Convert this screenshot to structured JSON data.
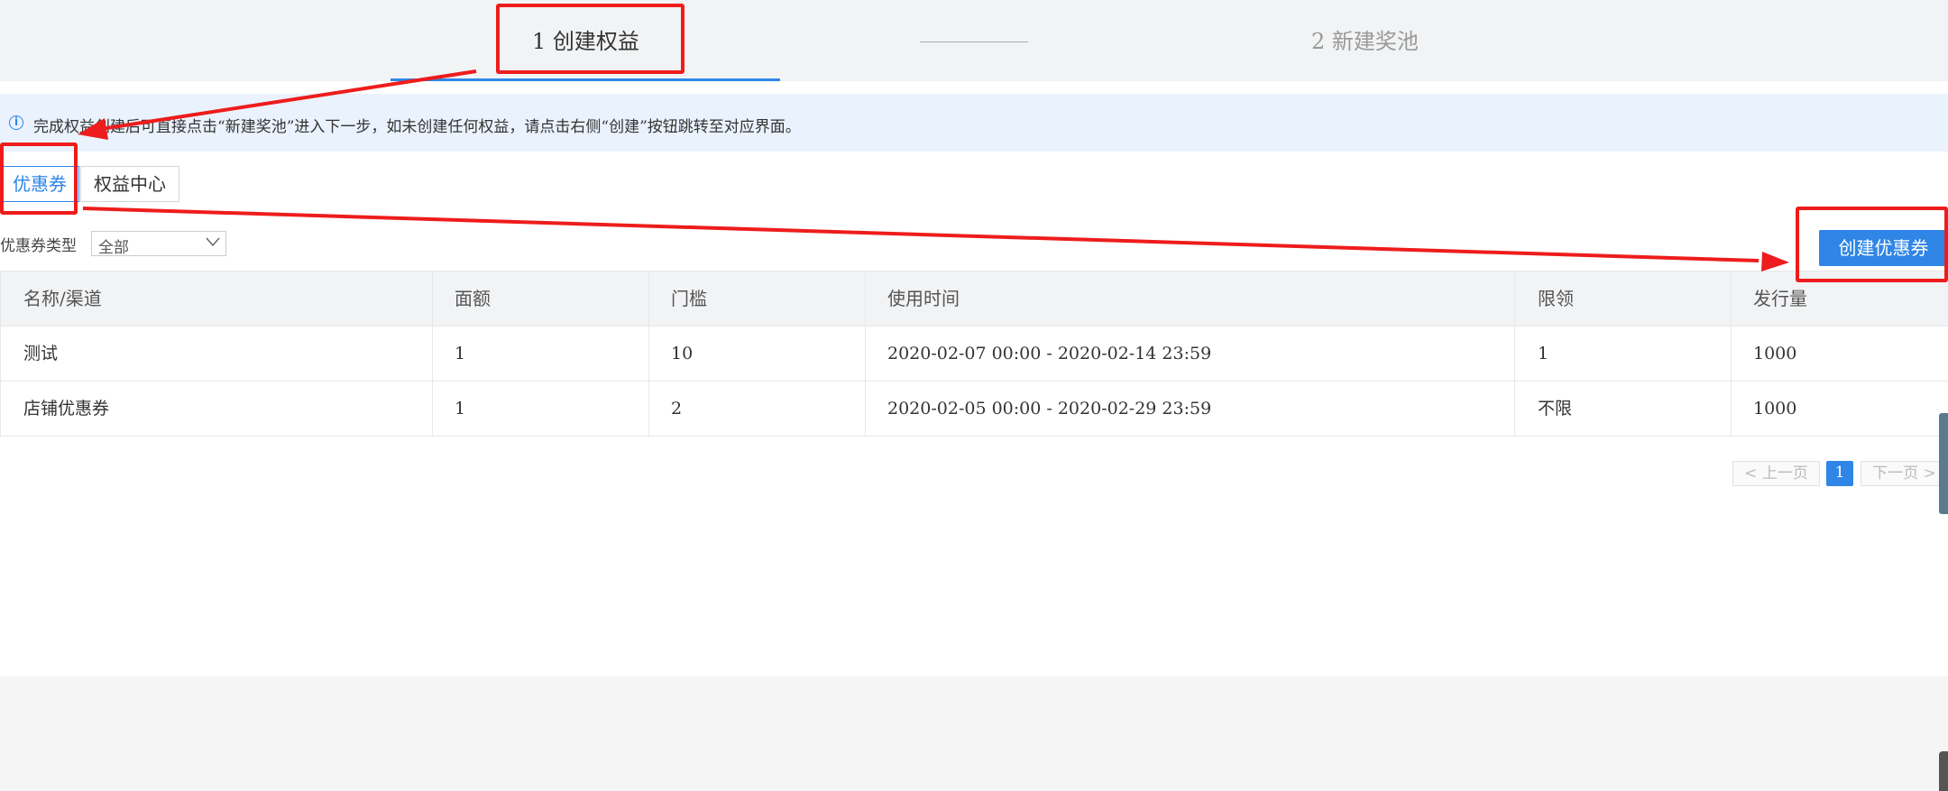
{
  "steps": {
    "step1": "1 创建权益",
    "step2": "2 新建奖池"
  },
  "notice": {
    "icon": "info-icon",
    "text": "完成权益创建后可直接点击“新建奖池”进入下一步，如未创建任何权益，请点击右侧“创建”按钮跳转至对应界面。"
  },
  "tabs": [
    {
      "label": "优惠券",
      "active": true
    },
    {
      "label": "权益中心",
      "active": false
    }
  ],
  "filter": {
    "label": "优惠券类型",
    "selected": "全部"
  },
  "create_button": "创建优惠券",
  "table": {
    "headers": [
      "名称/渠道",
      "面额",
      "门槛",
      "使用时间",
      "限领",
      "发行量"
    ],
    "rows": [
      [
        "测试",
        "1",
        "10",
        "2020-02-07 00:00 - 2020-02-14 23:59",
        "1",
        "1000"
      ],
      [
        "店铺优惠券",
        "1",
        "2",
        "2020-02-05 00:00 - 2020-02-29 23:59",
        "不限",
        "1000"
      ]
    ]
  },
  "pagination": {
    "prev": "上一页",
    "current": "1",
    "next": "下一页"
  },
  "colors": {
    "accent": "#2f86e7",
    "annotation": "#ee1c1c"
  }
}
